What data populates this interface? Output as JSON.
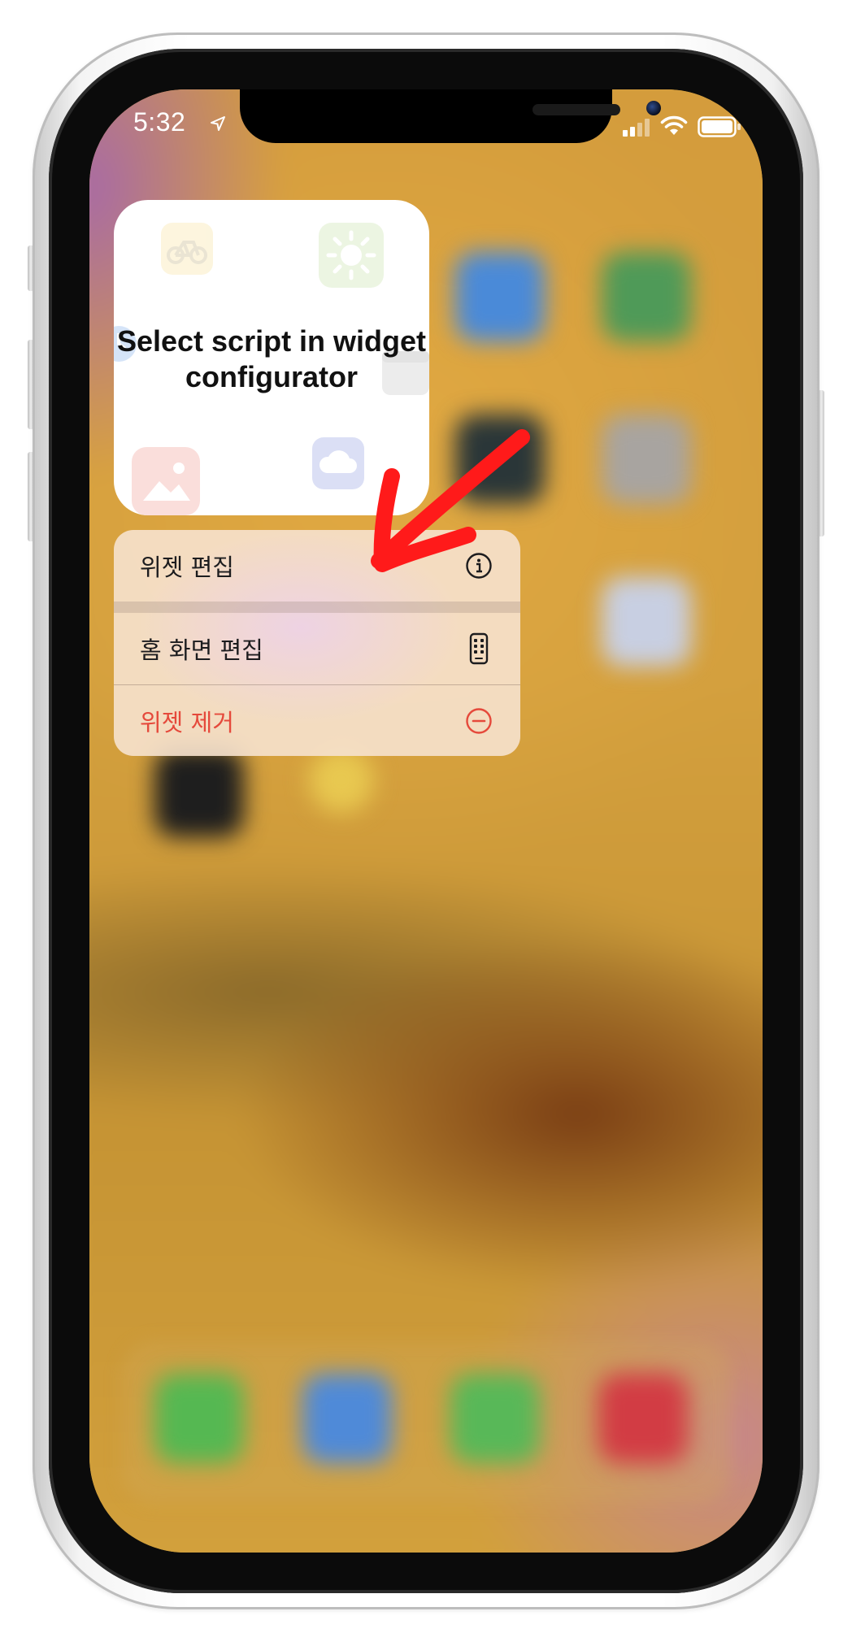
{
  "status_bar": {
    "time": "5:32",
    "location_icon": "location-arrow-icon",
    "signal_icon": "cellular-signal-icon",
    "wifi_icon": "wifi-icon",
    "battery_icon": "battery-icon"
  },
  "widget": {
    "message": "Select script in widget configurator"
  },
  "context_menu": {
    "items": [
      {
        "label": "위젯 편집",
        "icon": "info-circle-icon"
      },
      {
        "label": "홈 화면 편집",
        "icon": "phone-outline-icon"
      },
      {
        "label": "위젯 제거",
        "icon": "minus-circle-icon"
      }
    ]
  },
  "colors": {
    "destructive": "#e5493b",
    "annotation_arrow": "#ff1a1a"
  }
}
